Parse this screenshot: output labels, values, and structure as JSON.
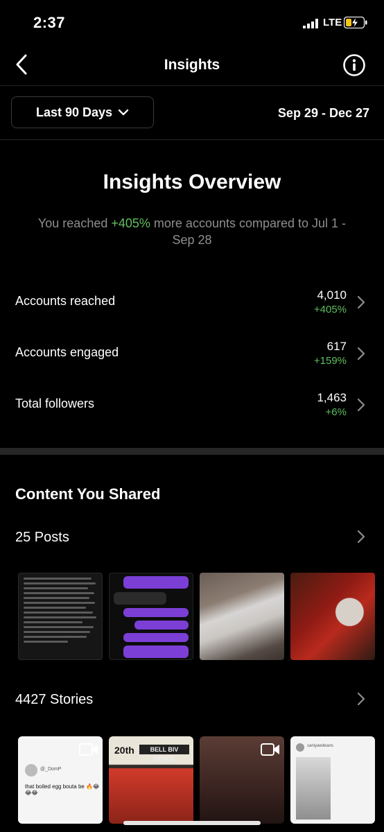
{
  "status_bar": {
    "time": "2:37",
    "network": "LTE"
  },
  "nav": {
    "title": "Insights"
  },
  "filter": {
    "range_label": "Last 90 Days",
    "date_range": "Sep 29 - Dec 27"
  },
  "overview": {
    "title": "Insights Overview",
    "subtitle_pre": "You reached ",
    "subtitle_pct": "+405%",
    "subtitle_post": " more accounts compared to Jul 1 - Sep 28",
    "metrics": [
      {
        "label": "Accounts reached",
        "value": "4,010",
        "change": "+405%"
      },
      {
        "label": "Accounts engaged",
        "value": "617",
        "change": "+159%"
      },
      {
        "label": "Total followers",
        "value": "1,463",
        "change": "+6%"
      }
    ]
  },
  "content": {
    "title": "Content You Shared",
    "posts_label": "25 Posts",
    "stories_label": "4427 Stories",
    "story_thumbs": {
      "s1_user": "@_DomP",
      "s1_text": "that boiled egg bouta be 🔥😂😂😂",
      "s2_logo": "20th",
      "s2_title": "BELL BIV DEVOE",
      "s4_user": "saniyaedwans"
    }
  },
  "colors": {
    "accent_green": "#5fbf5f",
    "background": "#000000",
    "divider": "#262626"
  }
}
